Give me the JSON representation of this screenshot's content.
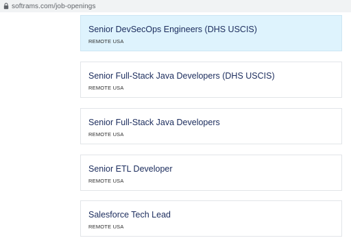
{
  "browser": {
    "url": "softrams.com/job-openings",
    "lock_icon": "lock-icon"
  },
  "jobs": [
    {
      "title": "Senior DevSecOps Engineers (DHS USCIS)",
      "location": "REMOTE USA",
      "highlighted": true
    },
    {
      "title": "Senior Full-Stack Java Developers (DHS USCIS)",
      "location": "REMOTE USA",
      "highlighted": false
    },
    {
      "title": "Senior Full-Stack Java Developers",
      "location": "REMOTE USA",
      "highlighted": false
    },
    {
      "title": "Senior ETL Developer",
      "location": "REMOTE USA",
      "highlighted": false
    },
    {
      "title": "Salesforce Tech Lead",
      "location": "REMOTE USA",
      "highlighted": false
    }
  ],
  "colors": {
    "highlight_bg": "#def3fd",
    "title_color": "#1a2b5c"
  }
}
